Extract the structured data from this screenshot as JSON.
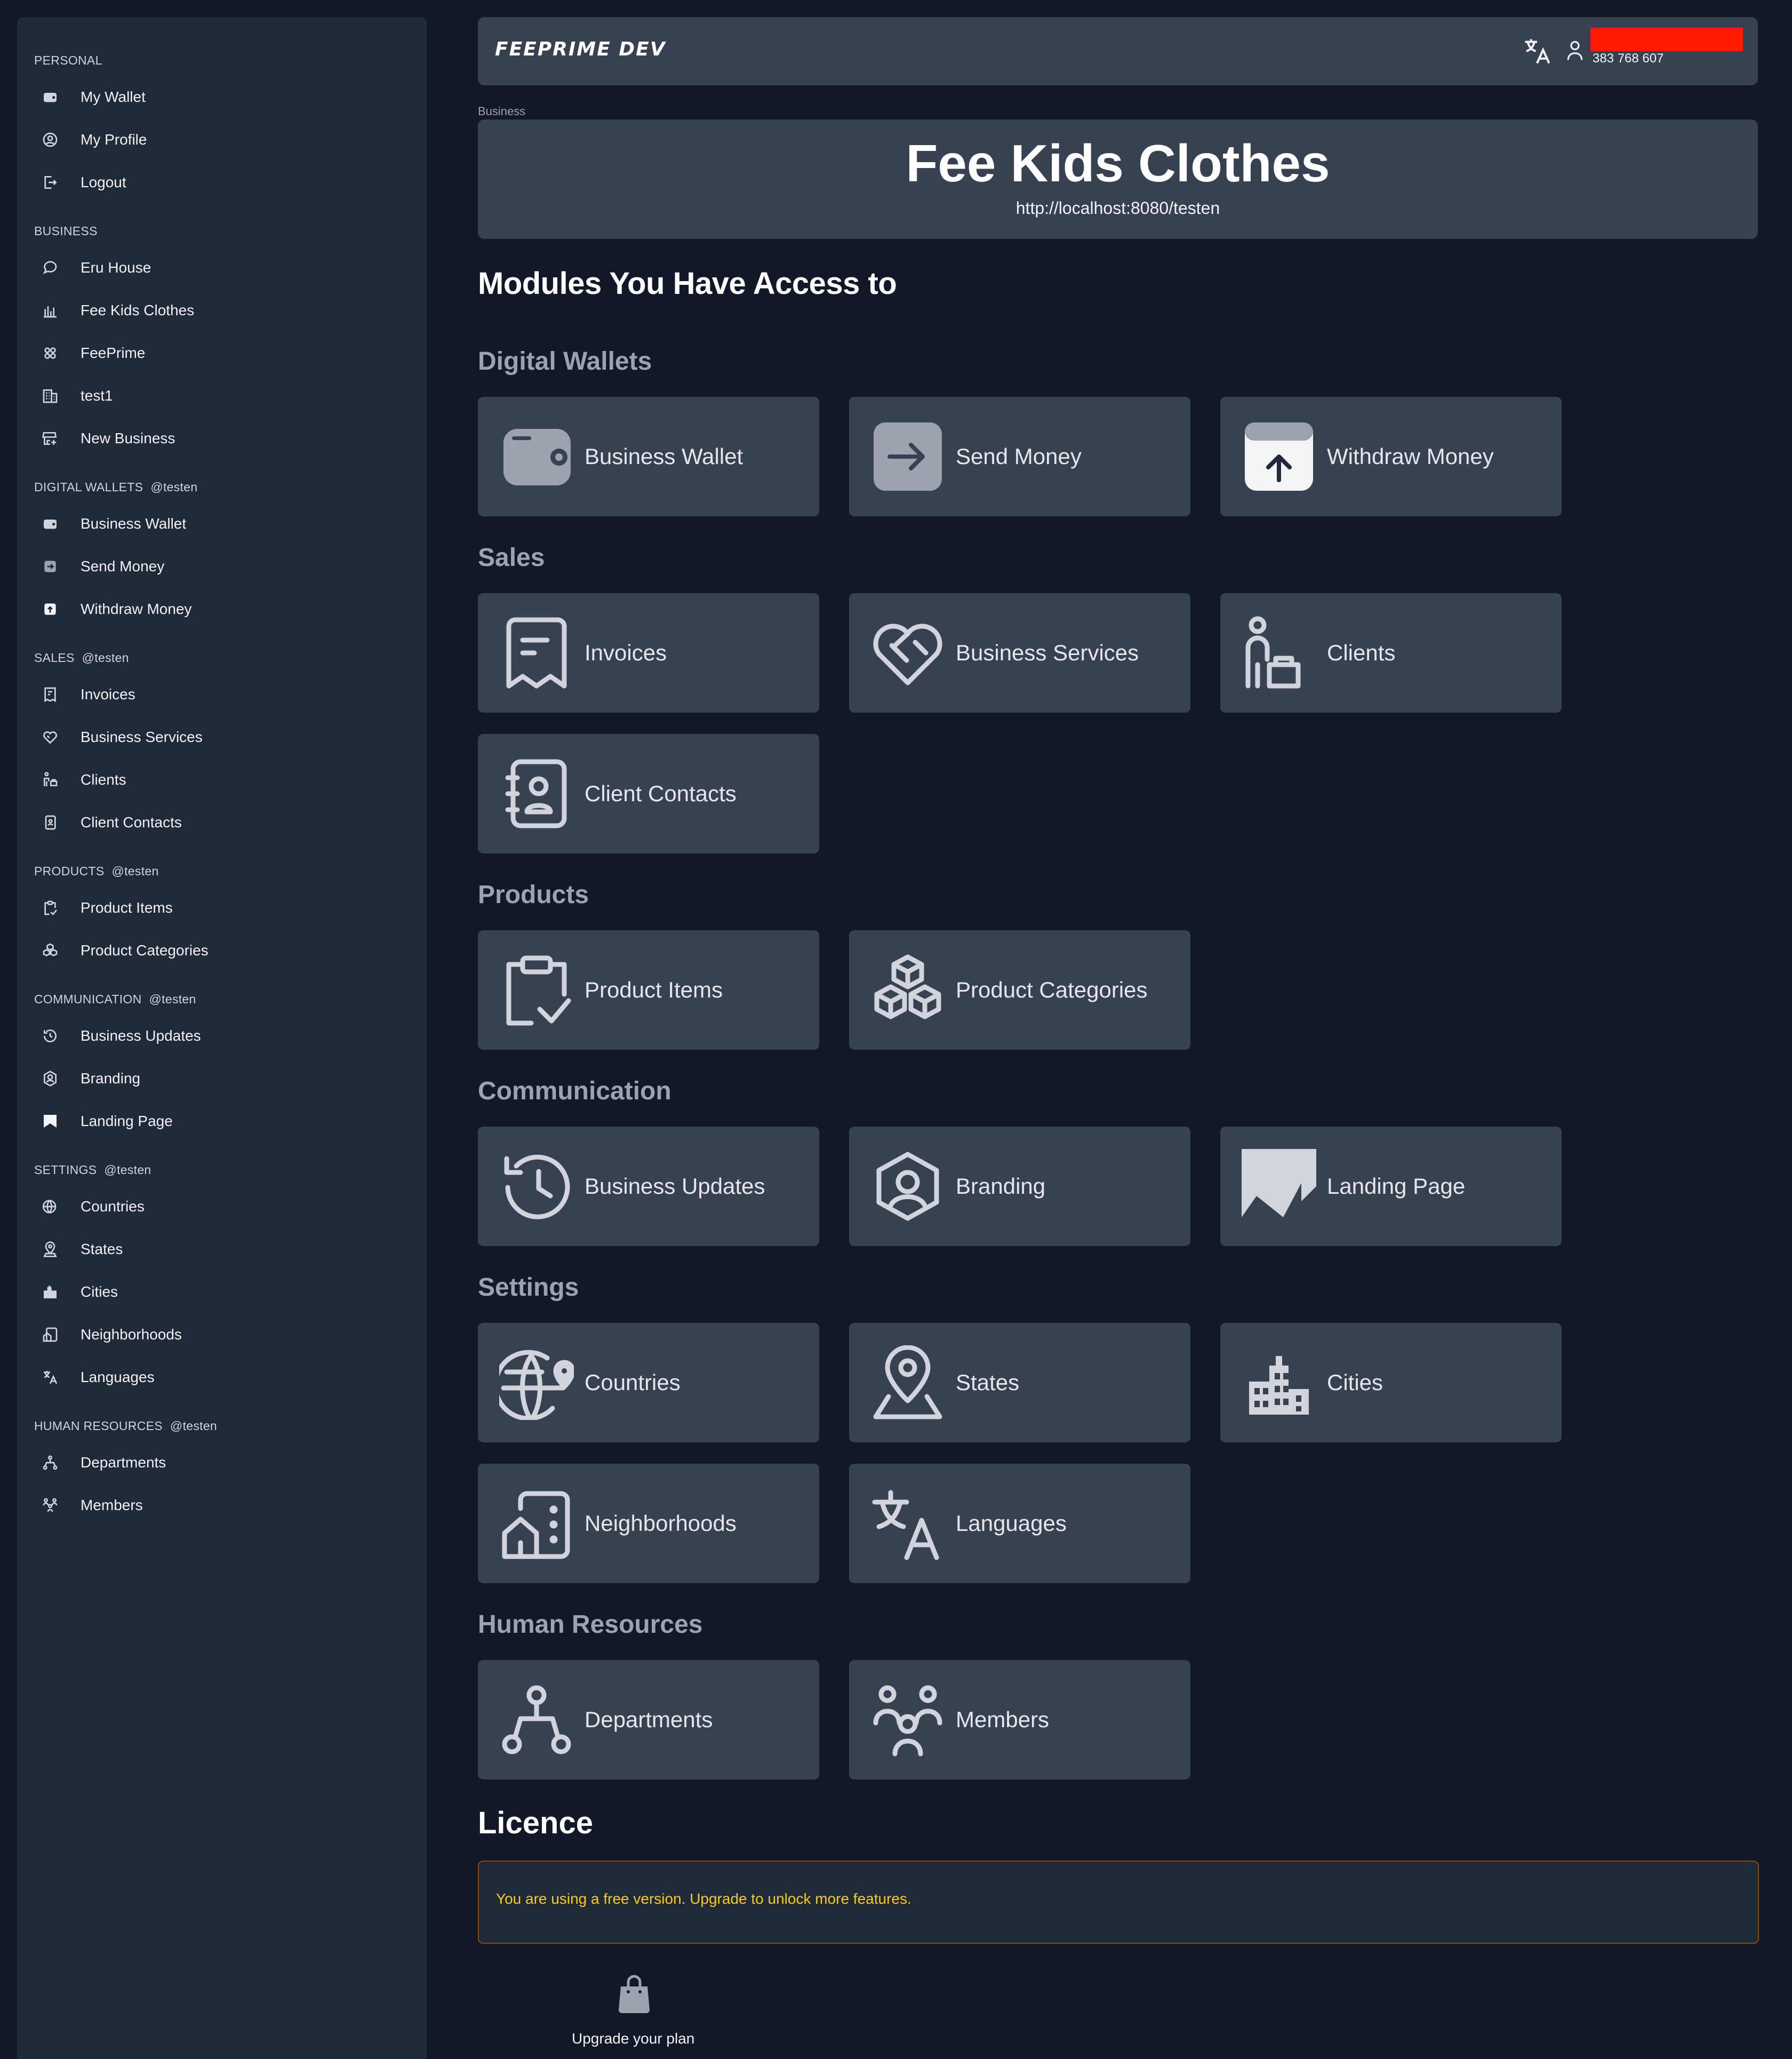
{
  "header": {
    "logo": "FEEPRIME DEV",
    "phone": "383 768 607"
  },
  "sidebar": {
    "sections": [
      {
        "title": "PERSONAL",
        "tag": "",
        "items": [
          {
            "label": "My Wallet",
            "icon": "wallet-icon"
          },
          {
            "label": "My Profile",
            "icon": "user-circle-icon"
          },
          {
            "label": "Logout",
            "icon": "logout-icon"
          }
        ]
      },
      {
        "title": "BUSINESS",
        "tag": "",
        "items": [
          {
            "label": "Eru House",
            "icon": "chat-icon"
          },
          {
            "label": "Fee Kids Clothes",
            "icon": "bar-chart-icon"
          },
          {
            "label": "FeePrime",
            "icon": "grid-icon"
          },
          {
            "label": "test1",
            "icon": "building-icon"
          },
          {
            "label": "New Business",
            "icon": "store-add-icon"
          }
        ]
      },
      {
        "title": "DIGITAL WALLETS",
        "tag": "@testen",
        "items": [
          {
            "label": "Business Wallet",
            "icon": "wallet-icon"
          },
          {
            "label": "Send Money",
            "icon": "send-icon"
          },
          {
            "label": "Withdraw Money",
            "icon": "withdraw-icon"
          }
        ]
      },
      {
        "title": "SALES",
        "tag": "@testen",
        "items": [
          {
            "label": "Invoices",
            "icon": "receipt-icon"
          },
          {
            "label": "Business Services",
            "icon": "heart-handshake-icon"
          },
          {
            "label": "Clients",
            "icon": "client-icon"
          },
          {
            "label": "Client Contacts",
            "icon": "address-book-icon"
          }
        ]
      },
      {
        "title": "PRODUCTS",
        "tag": "@testen",
        "items": [
          {
            "label": "Product Items",
            "icon": "clipboard-check-icon"
          },
          {
            "label": "Product Categories",
            "icon": "boxes-icon"
          }
        ]
      },
      {
        "title": "COMMUNICATION",
        "tag": "@testen",
        "items": [
          {
            "label": "Business Updates",
            "icon": "history-icon"
          },
          {
            "label": "Branding",
            "icon": "badge-user-icon"
          },
          {
            "label": "Landing Page",
            "icon": "bookmark-icon"
          }
        ]
      },
      {
        "title": "SETTINGS",
        "tag": "@testen",
        "items": [
          {
            "label": "Countries",
            "icon": "globe-pin-icon"
          },
          {
            "label": "States",
            "icon": "map-pin-icon"
          },
          {
            "label": "Cities",
            "icon": "city-icon"
          },
          {
            "label": "Neighborhoods",
            "icon": "neighborhood-icon"
          },
          {
            "label": "Languages",
            "icon": "language-icon"
          }
        ]
      },
      {
        "title": "HUMAN RESOURCES",
        "tag": "@testen",
        "items": [
          {
            "label": "Departments",
            "icon": "hierarchy-icon"
          },
          {
            "label": "Members",
            "icon": "users-group-icon"
          }
        ]
      }
    ]
  },
  "main": {
    "breadcrumb": "Business",
    "business_name": "Fee Kids Clothes",
    "business_url": "http://localhost:8080/testen",
    "modules_title": "Modules You Have Access to",
    "categories": [
      {
        "title": "Digital Wallets",
        "cards": [
          "Business Wallet",
          "Send Money",
          "Withdraw Money"
        ]
      },
      {
        "title": "Sales",
        "cards": [
          "Invoices",
          "Business Services",
          "Clients",
          "Client Contacts"
        ]
      },
      {
        "title": "Products",
        "cards": [
          "Product Items",
          "Product Categories"
        ]
      },
      {
        "title": "Communication",
        "cards": [
          "Business Updates",
          "Branding",
          "Landing Page"
        ]
      },
      {
        "title": "Settings",
        "cards": [
          "Countries",
          "States",
          "Cities",
          "Neighborhoods",
          "Languages"
        ]
      },
      {
        "title": "Human Resources",
        "cards": [
          "Departments",
          "Members"
        ]
      }
    ],
    "licence_title": "Licence",
    "licence_text": "You are using a free version. Upgrade to unlock more features.",
    "upgrade_label": "Upgrade your plan"
  },
  "colors": {
    "background": "#111827",
    "panel": "#1f2937",
    "card": "#374151",
    "licence_border": "#78501c",
    "licence_text": "#facc15",
    "redaction": "#ff1a00"
  }
}
